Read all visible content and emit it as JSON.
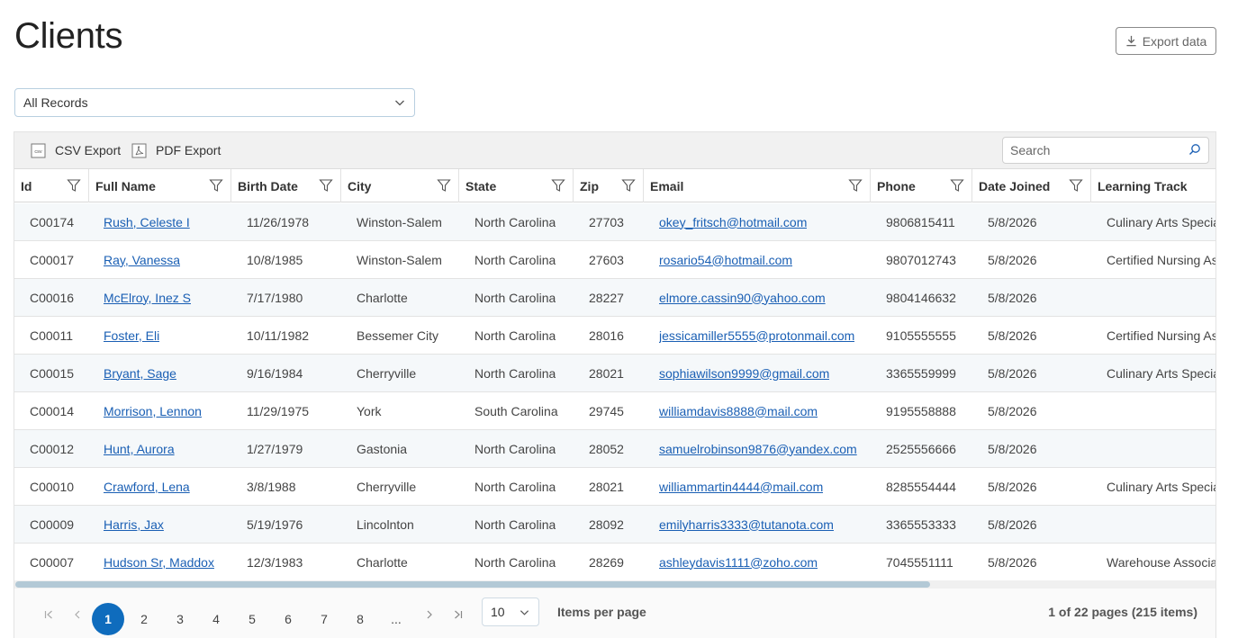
{
  "page": {
    "title": "Clients",
    "export_label": "Export data"
  },
  "filter": {
    "selected": "All Records"
  },
  "toolbar": {
    "csv_label": "CSV Export",
    "csv_icon_text": "csv",
    "pdf_label": "PDF Export",
    "search_placeholder": "Search"
  },
  "columns": [
    "Id",
    "Full Name",
    "Birth Date",
    "City",
    "State",
    "Zip",
    "Email",
    "Phone",
    "Date Joined",
    "Learning Track"
  ],
  "rows": [
    [
      "C00174",
      "Rush, Celeste I",
      "11/26/1978",
      "Winston-Salem",
      "North Carolina",
      "27703",
      "okey_fritsch@hotmail.com",
      "9806815411",
      "5/8/2026",
      "Culinary Arts Specia"
    ],
    [
      "C00017",
      "Ray, Vanessa",
      "10/8/1985",
      "Winston-Salem",
      "North Carolina",
      "27603",
      "rosario54@hotmail.com",
      "9807012743",
      "5/8/2026",
      "Certified Nursing As"
    ],
    [
      "C00016",
      "McElroy, Inez S",
      "7/17/1980",
      "Charlotte",
      "North Carolina",
      "28227",
      "elmore.cassin90@yahoo.com",
      "9804146632",
      "5/8/2026",
      ""
    ],
    [
      "C00011",
      "Foster, Eli",
      "10/11/1982",
      "Bessemer City",
      "North Carolina",
      "28016",
      "jessicamiller5555@protonmail.com",
      "9105555555",
      "5/8/2026",
      "Certified Nursing As"
    ],
    [
      "C00015",
      "Bryant, Sage",
      "9/16/1984",
      "Cherryville",
      "North Carolina",
      "28021",
      "sophiawilson9999@gmail.com",
      "3365559999",
      "5/8/2026",
      "Culinary Arts Specia"
    ],
    [
      "C00014",
      "Morrison, Lennon",
      "11/29/1975",
      "York",
      "South Carolina",
      "29745",
      "williamdavis8888@mail.com",
      "9195558888",
      "5/8/2026",
      ""
    ],
    [
      "C00012",
      "Hunt, Aurora",
      "1/27/1979",
      "Gastonia",
      "North Carolina",
      "28052",
      "samuelrobinson9876@yandex.com",
      "2525556666",
      "5/8/2026",
      ""
    ],
    [
      "C00010",
      "Crawford, Lena",
      "3/8/1988",
      "Cherryville",
      "North Carolina",
      "28021",
      "williammartin4444@mail.com",
      "8285554444",
      "5/8/2026",
      "Culinary Arts Specia"
    ],
    [
      "C00009",
      "Harris, Jax",
      "5/19/1976",
      "Lincolnton",
      "North Carolina",
      "28092",
      "emilyharris3333@tutanota.com",
      "3365553333",
      "5/8/2026",
      ""
    ],
    [
      "C00007",
      "Hudson Sr, Maddox",
      "12/3/1983",
      "Charlotte",
      "North Carolina",
      "28269",
      "ashleydavis1111@zoho.com",
      "7045551111",
      "5/8/2026",
      "Warehouse Associat"
    ]
  ],
  "pager": {
    "pages": [
      "1",
      "2",
      "3",
      "4",
      "5",
      "6",
      "7",
      "8",
      "..."
    ],
    "current_page": "1",
    "page_size": "10",
    "items_per_page_label": "Items per page",
    "info": "1 of 22 pages (215 items)"
  },
  "colors": {
    "accent": "#0f6cbd",
    "link": "#1a5fb4",
    "toolbar_bg": "#f1f1f1",
    "row_alt_bg": "#f5f8fa",
    "scroll_thumb": "#b3c9d6"
  }
}
